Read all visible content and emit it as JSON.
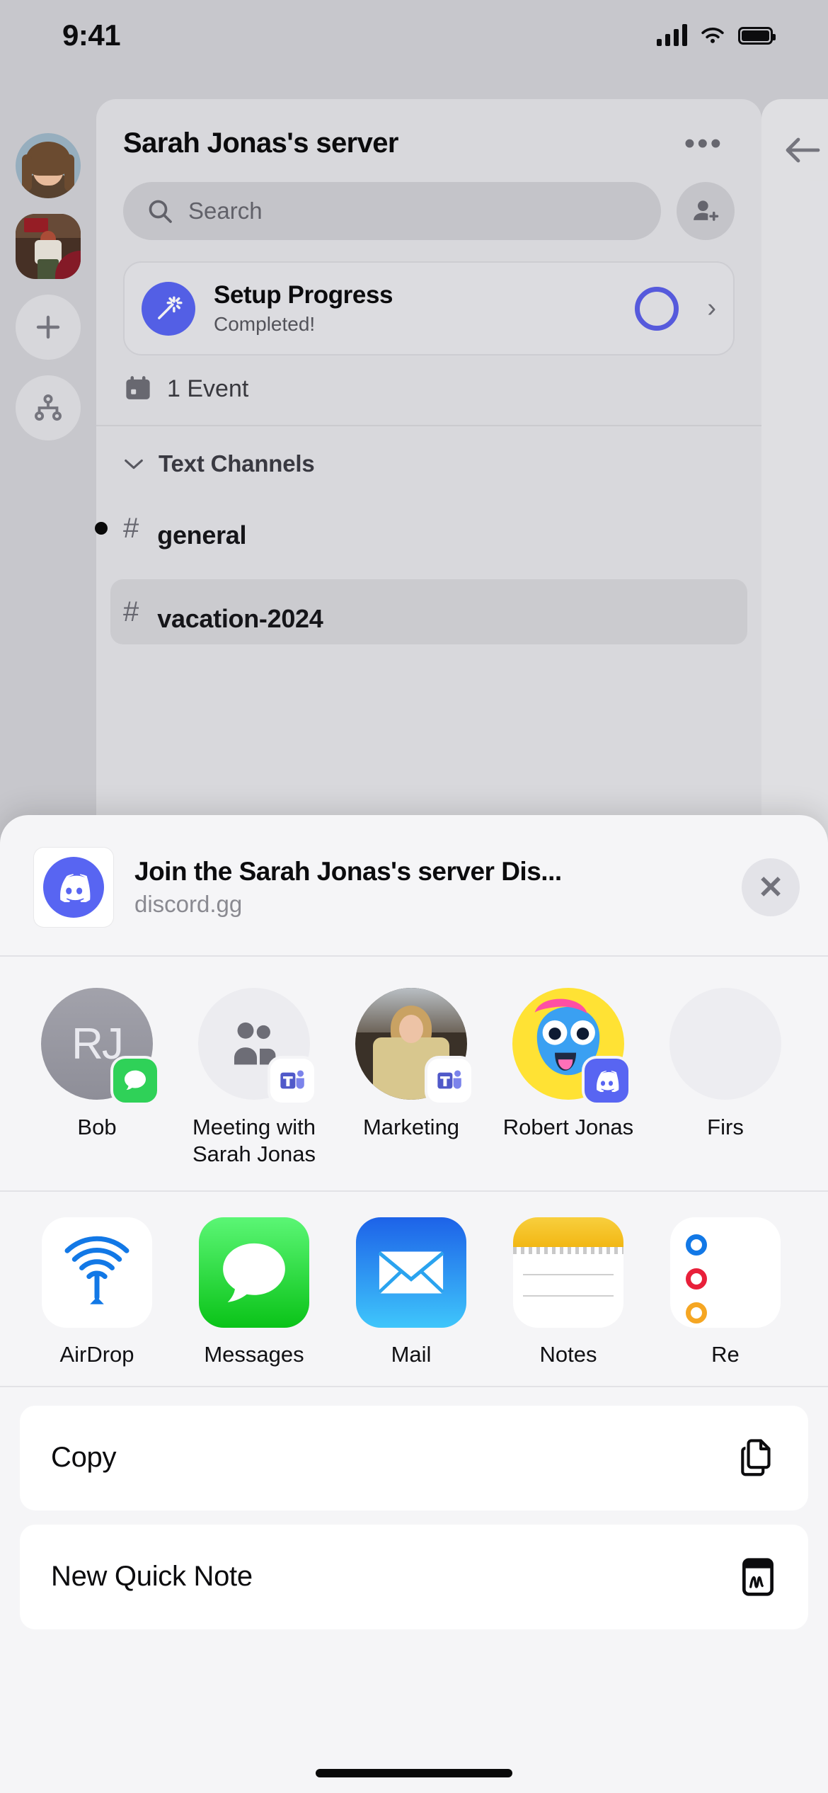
{
  "status_bar": {
    "time": "9:41",
    "cellular_icon": "signal-bars-icon",
    "wifi_icon": "wifi-icon",
    "battery_icon": "battery-icon"
  },
  "discord": {
    "server_title": "Sarah Jonas's server",
    "more_options": "•••",
    "search": {
      "placeholder": "Search"
    },
    "invite_icon": "add-person-icon",
    "setup_card": {
      "title": "Setup Progress",
      "subtitle": "Completed!",
      "icon": "magic-wand-icon",
      "progress_ring_color": "#5b5fe8",
      "chevron": "›"
    },
    "events": {
      "icon": "calendar-icon",
      "label": "1 Event"
    },
    "channel_section": {
      "chevron": "⌄",
      "label": "Text Channels"
    },
    "channels": [
      {
        "hash": "#",
        "name": "general",
        "unread": true,
        "selected": false
      },
      {
        "hash": "#",
        "name": "vacation-2024",
        "unread": false,
        "selected": true
      }
    ],
    "back_arrow_icon": "arrow-left-icon",
    "accent_color": "#5865f2"
  },
  "share_sheet": {
    "link": {
      "title": "Join the Sarah Jonas's server Dis...",
      "domain": "discord.gg",
      "thumb_icon": "discord-logo-icon"
    },
    "close_label": "✕",
    "contacts": [
      {
        "name": "Bob",
        "initials": "RJ",
        "badge": "messages-icon",
        "avatar": "initials"
      },
      {
        "name": "Meeting with Sarah Jonas",
        "badge": "teams-icon",
        "avatar": "group-icon"
      },
      {
        "name": "Marketing",
        "badge": "teams-icon",
        "avatar": "photo"
      },
      {
        "name": "Robert Jonas",
        "badge": "discord-icon",
        "avatar": "illustration"
      },
      {
        "name": "Firs",
        "badge": "",
        "avatar": "photo"
      }
    ],
    "apps": [
      {
        "name": "AirDrop",
        "icon": "airdrop-icon"
      },
      {
        "name": "Messages",
        "icon": "messages-icon"
      },
      {
        "name": "Mail",
        "icon": "mail-icon"
      },
      {
        "name": "Notes",
        "icon": "notes-icon"
      },
      {
        "name": "Re",
        "icon": "reminders-icon"
      }
    ],
    "actions": [
      {
        "label": "Copy",
        "icon": "copy-icon"
      },
      {
        "label": "New Quick Note",
        "icon": "quick-note-icon"
      }
    ]
  }
}
